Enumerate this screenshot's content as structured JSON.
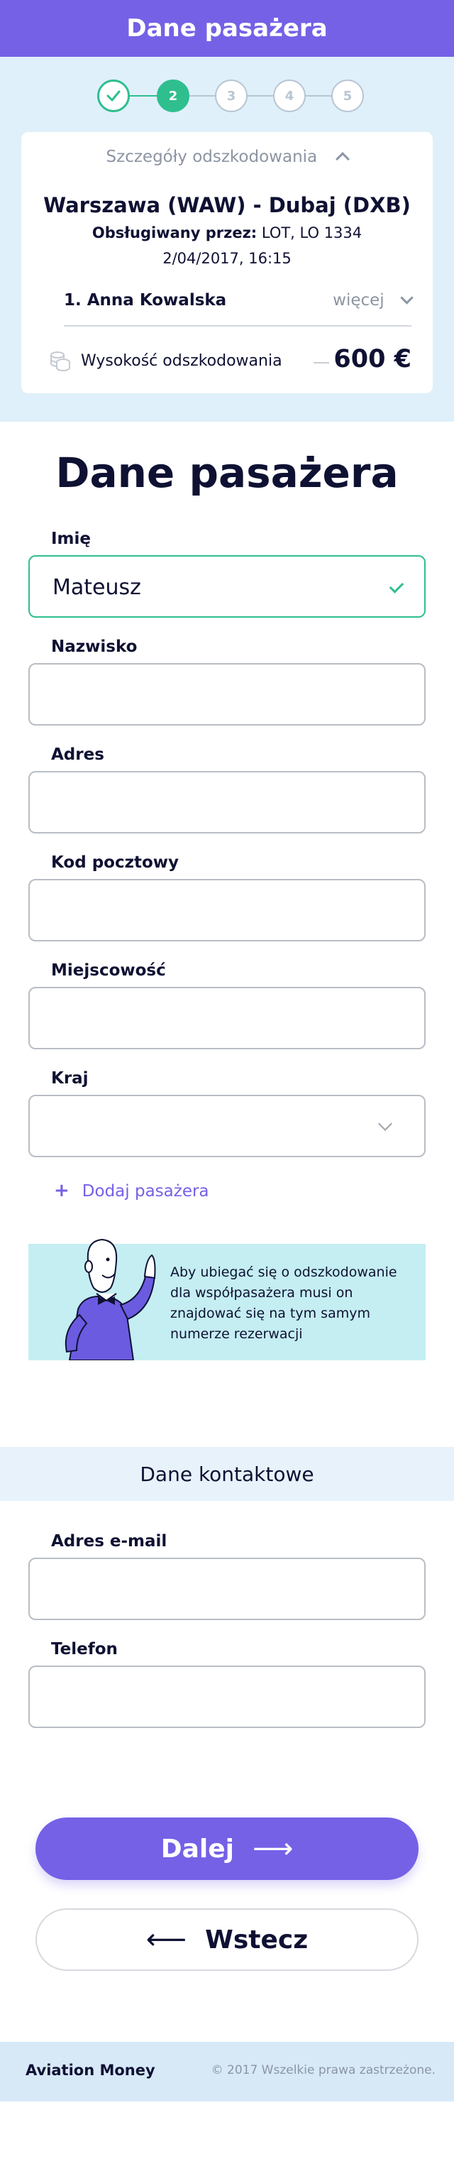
{
  "header": {
    "title": "Dane pasażera"
  },
  "stepper": {
    "steps": [
      {
        "label": "",
        "state": "done"
      },
      {
        "label": "2",
        "state": "active"
      },
      {
        "label": "3",
        "state": "pending"
      },
      {
        "label": "4",
        "state": "pending"
      },
      {
        "label": "5",
        "state": "pending"
      }
    ]
  },
  "summary": {
    "toggle_label": "Szczegóły odszkodowania",
    "route": "Warszawa (WAW) - Dubaj (DXB)",
    "operated_label": "Obsługiwany przez:",
    "operated_value": " LOT, LO 1334",
    "date": "2/04/2017, 16:15",
    "passenger": "1. Anna Kowalska",
    "more_label": "więcej",
    "compensation_label": "Wysokość odszkodowania",
    "compensation_amount": "600 €"
  },
  "form": {
    "title": "Dane pasażera",
    "fields": {
      "first_name": {
        "label": "Imię",
        "value": "Mateusz"
      },
      "last_name": {
        "label": "Nazwisko",
        "value": ""
      },
      "address": {
        "label": "Adres",
        "value": ""
      },
      "postal_code": {
        "label": "Kod pocztowy",
        "value": ""
      },
      "city": {
        "label": "Miejscowość",
        "value": ""
      },
      "country": {
        "label": "Kraj",
        "value": ""
      }
    },
    "add_passenger_label": "Dodaj pasażera",
    "info_text": "Aby ubiegać się o odszkodowanie dla współpasażera musi on znajdować się na tym samym numerze rezerwacji"
  },
  "contact": {
    "section_title": "Dane kontaktowe",
    "email_label": "Adres e-mail",
    "email_value": "",
    "phone_label": "Telefon",
    "phone_value": ""
  },
  "actions": {
    "next_label": "Dalej",
    "back_label": "Wstecz"
  },
  "footer": {
    "brand": "Aviation Money",
    "copyright": "© 2017 Wszelkie prawa zastrzeżone."
  },
  "colors": {
    "brand": "#7461e6",
    "success": "#2fbf8f",
    "summary_bg": "#dff0fb",
    "info_bg": "#c4eef2"
  },
  "icons": [
    "check-icon",
    "chevron-up-icon",
    "chevron-down-icon",
    "coins-icon",
    "plus-icon",
    "arrow-right-icon",
    "arrow-left-icon"
  ]
}
